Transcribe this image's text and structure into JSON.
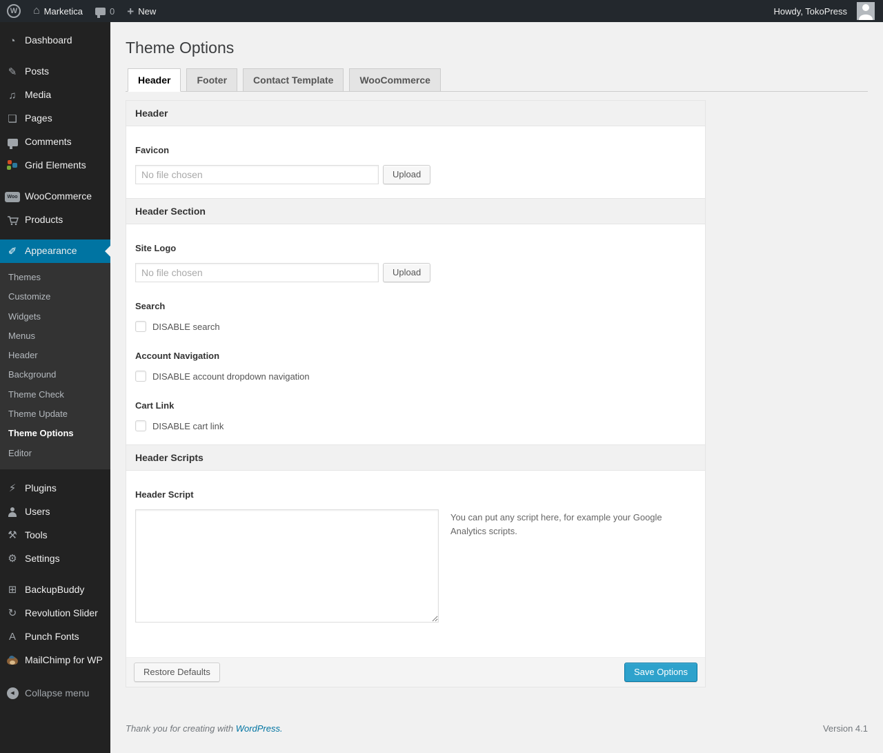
{
  "admin_bar": {
    "site_name": "Marketica",
    "comments_count": "0",
    "new_label": "New",
    "howdy": "Howdy, TokoPress"
  },
  "icons": {
    "wp_logo": "W",
    "home": "⌂",
    "plus": "+",
    "dashboard": "◔",
    "posts": "✎",
    "media": "♫",
    "pages": "❏",
    "woocommerce_badge": "Woo",
    "appearance": "✐",
    "plugins": "⚡",
    "tools": "⚒",
    "settings": "⚙",
    "backupbuddy": "⊞",
    "revolution_slider": "↻",
    "punch_fonts": "A",
    "collapse_arrow": "◀"
  },
  "sidebar": {
    "items": {
      "dashboard": "Dashboard",
      "posts": "Posts",
      "media": "Media",
      "pages": "Pages",
      "comments": "Comments",
      "grid_elements": "Grid Elements",
      "woocommerce": "WooCommerce",
      "products": "Products",
      "appearance": "Appearance",
      "plugins": "Plugins",
      "users": "Users",
      "tools": "Tools",
      "settings": "Settings",
      "backupbuddy": "BackupBuddy",
      "revolution_slider": "Revolution Slider",
      "punch_fonts": "Punch Fonts",
      "mailchimp": "MailChimp for WP",
      "collapse": "Collapse menu"
    },
    "appearance_submenu": [
      "Themes",
      "Customize",
      "Widgets",
      "Menus",
      "Header",
      "Background",
      "Theme Check",
      "Theme Update",
      "Theme Options",
      "Editor"
    ],
    "current_submenu_item": "Theme Options"
  },
  "page": {
    "title": "Theme Options",
    "tabs": [
      "Header",
      "Footer",
      "Contact Template",
      "WooCommerce"
    ],
    "active_tab": "Header"
  },
  "panel": {
    "sections": {
      "header": {
        "title": "Header"
      },
      "header_section": {
        "title": "Header Section"
      },
      "header_scripts": {
        "title": "Header Scripts"
      }
    },
    "favicon": {
      "label": "Favicon",
      "placeholder": "No file chosen",
      "upload_label": "Upload"
    },
    "site_logo": {
      "label": "Site Logo",
      "placeholder": "No file chosen",
      "upload_label": "Upload"
    },
    "search": {
      "label": "Search",
      "checkbox_label": "DISABLE search",
      "checked": false
    },
    "account_navigation": {
      "label": "Account Navigation",
      "checkbox_label": "DISABLE account dropdown navigation",
      "checked": false
    },
    "cart_link": {
      "label": "Cart Link",
      "checkbox_label": "DISABLE cart link",
      "checked": false
    },
    "header_script": {
      "label": "Header Script",
      "value": "",
      "hint": "You can put any script here, for example your Google Analytics scripts."
    },
    "restore_button": "Restore Defaults",
    "save_button": "Save Options"
  },
  "footer": {
    "thanks_text": "Thank you for creating with",
    "thanks_link": "WordPress.",
    "version": "Version 4.1"
  },
  "colors": {
    "accent": "#0074a2",
    "primary_button": "#2ea2cc",
    "admin_bar_bg": "#23282d",
    "menu_bg": "#222222",
    "submenu_bg": "#333333",
    "page_bg": "#f1f1f1"
  }
}
